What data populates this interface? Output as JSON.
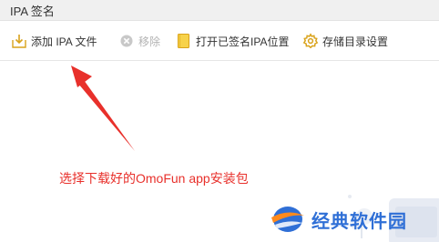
{
  "window": {
    "title": "IPA 签名"
  },
  "toolbar": {
    "add_label": "添加 IPA 文件",
    "remove_label": "移除",
    "open_folder_label": "打开已签名IPA位置",
    "settings_label": "存储目录设置"
  },
  "icons": {
    "add": "import-file-icon",
    "remove": "remove-circle-icon",
    "open_folder": "folder-icon",
    "settings": "gear-icon"
  },
  "annotation": {
    "text": "选择下载好的OmoFun app安装包",
    "color": "#e8302b"
  },
  "watermark": {
    "text": "经典软件园"
  }
}
